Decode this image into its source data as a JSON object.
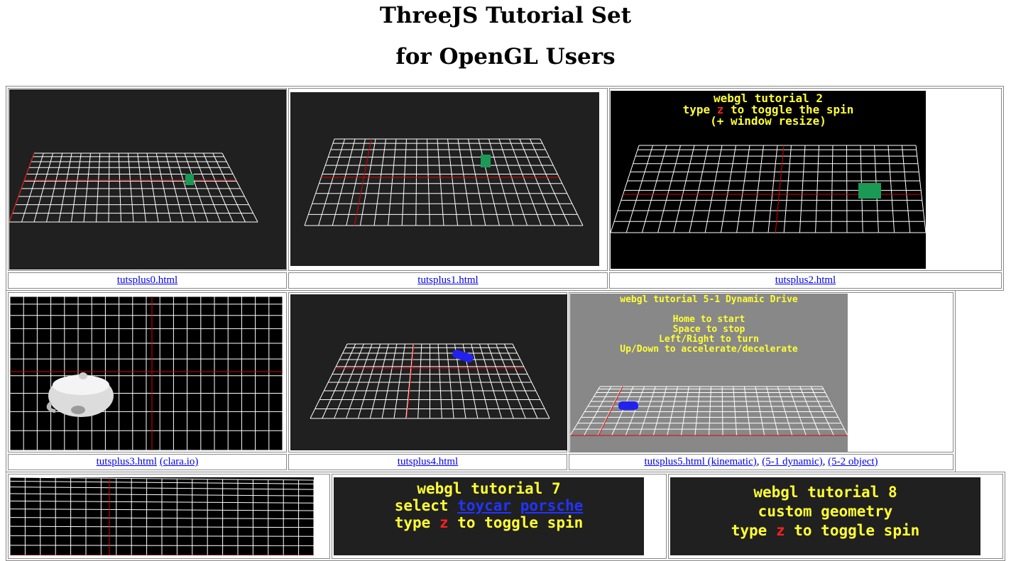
{
  "page": {
    "title_line1": "ThreeJS Tutorial Set",
    "title_line2": "for OpenGL Users"
  },
  "rows": [
    {
      "captions": [
        {
          "links": [
            "tutsplus0.html"
          ]
        },
        {
          "links": [
            "tutsplus1.html"
          ]
        },
        {
          "links": [
            "tutsplus2.html"
          ]
        }
      ]
    },
    {
      "captions": [
        {
          "links": [
            "tutsplus3.html",
            "(clara.io)"
          ]
        },
        {
          "links": [
            "tutsplus4.html"
          ]
        },
        {
          "links": [
            "tutsplus5.html (kinematic)",
            "(5-1 dynamic)",
            "(5-2 object)"
          ]
        }
      ]
    }
  ],
  "overlays": {
    "t2": {
      "line1": "webgl tutorial 2",
      "line2_pre": "type ",
      "line2_key": "z",
      "line2_post": " to toggle the spin",
      "line3": "(+ window resize)"
    },
    "t5": {
      "line1": "webgl tutorial 5-1 Dynamic Drive",
      "line2": "Home to start",
      "line3": "Space to stop",
      "line4": "Left/Right to turn",
      "line5": "Up/Down to accelerate/decelerate"
    },
    "t7": {
      "line1": "webgl tutorial 7",
      "line2_pre": "select ",
      "link1": "toycar",
      "link2": "porsche",
      "line3_pre": "type ",
      "line3_key": "z",
      "line3_post": " to toggle spin"
    },
    "t8": {
      "line1": "webgl tutorial 8",
      "line2": "custom geometry",
      "line3_pre": "type ",
      "line3_key": "z",
      "line3_post": " to toggle spin"
    }
  },
  "colors": {
    "dark_bg": "#202020",
    "black_bg": "#000000",
    "gray_bg": "#888888",
    "grid_line": "#ffffff",
    "axis_line": "#e00000",
    "overlay_text": "#ffff33",
    "key_text": "#ff2020",
    "link": "#0000ee"
  }
}
